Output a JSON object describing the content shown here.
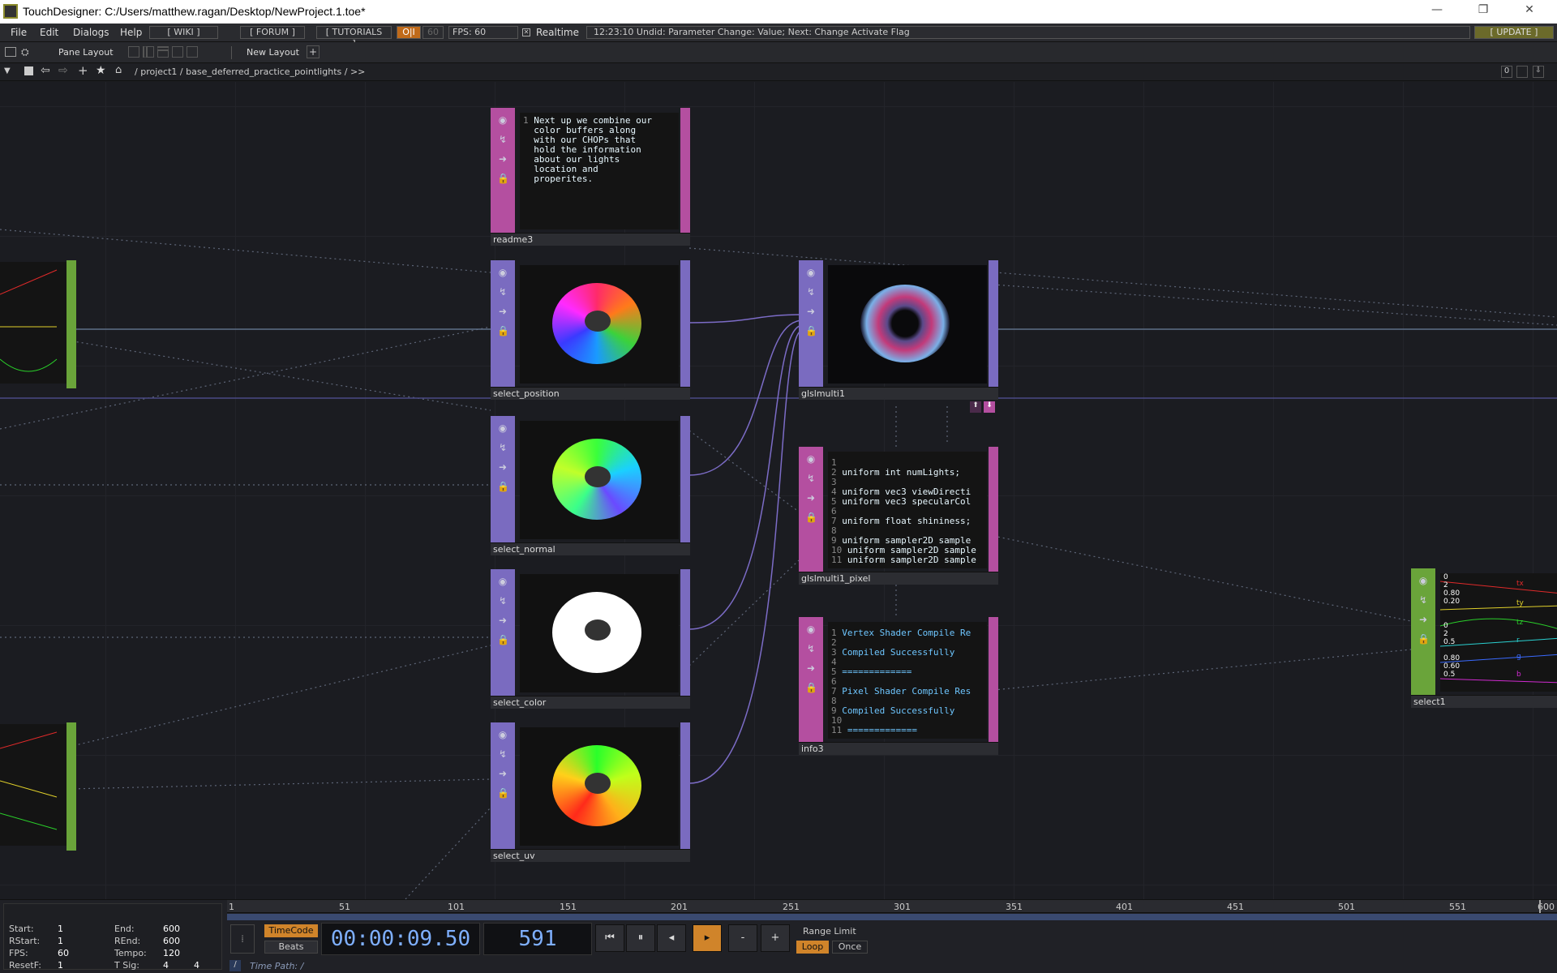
{
  "window": {
    "title": "TouchDesigner: C:/Users/matthew.ragan/Desktop/NewProject.1.toe*",
    "min": "—",
    "max": "❐",
    "close": "✕"
  },
  "menu": {
    "file": "File",
    "edit": "Edit",
    "dialogs": "Dialogs",
    "help": "Help",
    "wiki": "[ WIKI ]",
    "forum": "[ FORUM ]",
    "tutorials": "[ TUTORIALS ]",
    "oi": "O|I",
    "fps_cap": "60",
    "fps_label": "FPS:",
    "fps": "60",
    "realtime": "Realtime",
    "status": "12:23:10 Undid: Parameter Change: Value; Next: Change Activate Flag",
    "update": "[ UPDATE ]"
  },
  "toolbar": {
    "pane_layout": "Pane Layout",
    "new_layout": "New Layout",
    "plus": "+"
  },
  "path": {
    "root": "/",
    "project": "project1",
    "sep": "/",
    "network": "base_deferred_practice_pointlights",
    "more": ">>",
    "right_value": "0"
  },
  "nodes": {
    "readme3": {
      "name": "readme3",
      "lines": [
        "Next up we combine our",
        "color buffers along",
        "with our CHOPs that",
        "hold the information",
        "about our lights",
        "location and",
        "properites."
      ]
    },
    "select_position": {
      "name": "select_position"
    },
    "select_normal": {
      "name": "select_normal"
    },
    "select_color": {
      "name": "select_color"
    },
    "select_uv": {
      "name": "select_uv"
    },
    "glslmulti1": {
      "name": "glslmulti1"
    },
    "glslmulti1_pixel": {
      "name": "glslmulti1_pixel",
      "lines": [
        "uniform int numLights;",
        "",
        "uniform vec3 viewDirecti",
        "uniform vec3 specularCol",
        "",
        "uniform float shininess;",
        "",
        "uniform sampler2D sample",
        "uniform sampler2D sample",
        "uniform sampler2D sample"
      ]
    },
    "info3": {
      "name": "info3",
      "lines": [
        "Vertex Shader Compile Re",
        "",
        "Compiled Successfully",
        "",
        "=============",
        "",
        "Pixel Shader Compile Res",
        "",
        "Compiled Successfully",
        "",
        "============="
      ]
    },
    "select1": {
      "name": "select1",
      "labels": [
        "tx",
        "ty",
        "tz",
        "r",
        "g",
        "b"
      ],
      "values": [
        "0",
        "2",
        "0.80",
        "0.20",
        "0",
        "2",
        "0.5",
        "0.80",
        "0.60",
        "0.5"
      ]
    }
  },
  "timeline": {
    "ticks": [
      "1",
      "51",
      "101",
      "151",
      "201",
      "251",
      "301",
      "351",
      "401",
      "451",
      "501",
      "551",
      "600"
    ],
    "start_label": "Start:",
    "start": "1",
    "end_label": "End:",
    "end": "600",
    "rstart_label": "RStart:",
    "rstart": "1",
    "rend_label": "REnd:",
    "rend": "600",
    "fps_label": "FPS:",
    "fps": "60",
    "tempo_label": "Tempo:",
    "tempo": "120",
    "resetf_label": "ResetF:",
    "resetf": "1",
    "tsig_label": "T Sig:",
    "tsig_a": "4",
    "tsig_b": "4",
    "timecode_btn": "TimeCode",
    "beats_btn": "Beats",
    "timecode": "00:00:09.50",
    "frame": "591",
    "range_limit": "Range Limit",
    "loop": "Loop",
    "once": "Once",
    "minus": "-",
    "plus": "+",
    "time_path": "Time Path: /",
    "slash": "/"
  },
  "colors": {
    "top_node": "#c87fb8",
    "chop_node": "#7a6bc0",
    "dat_node": "#b44fa0",
    "accent": "#e08a2a"
  }
}
